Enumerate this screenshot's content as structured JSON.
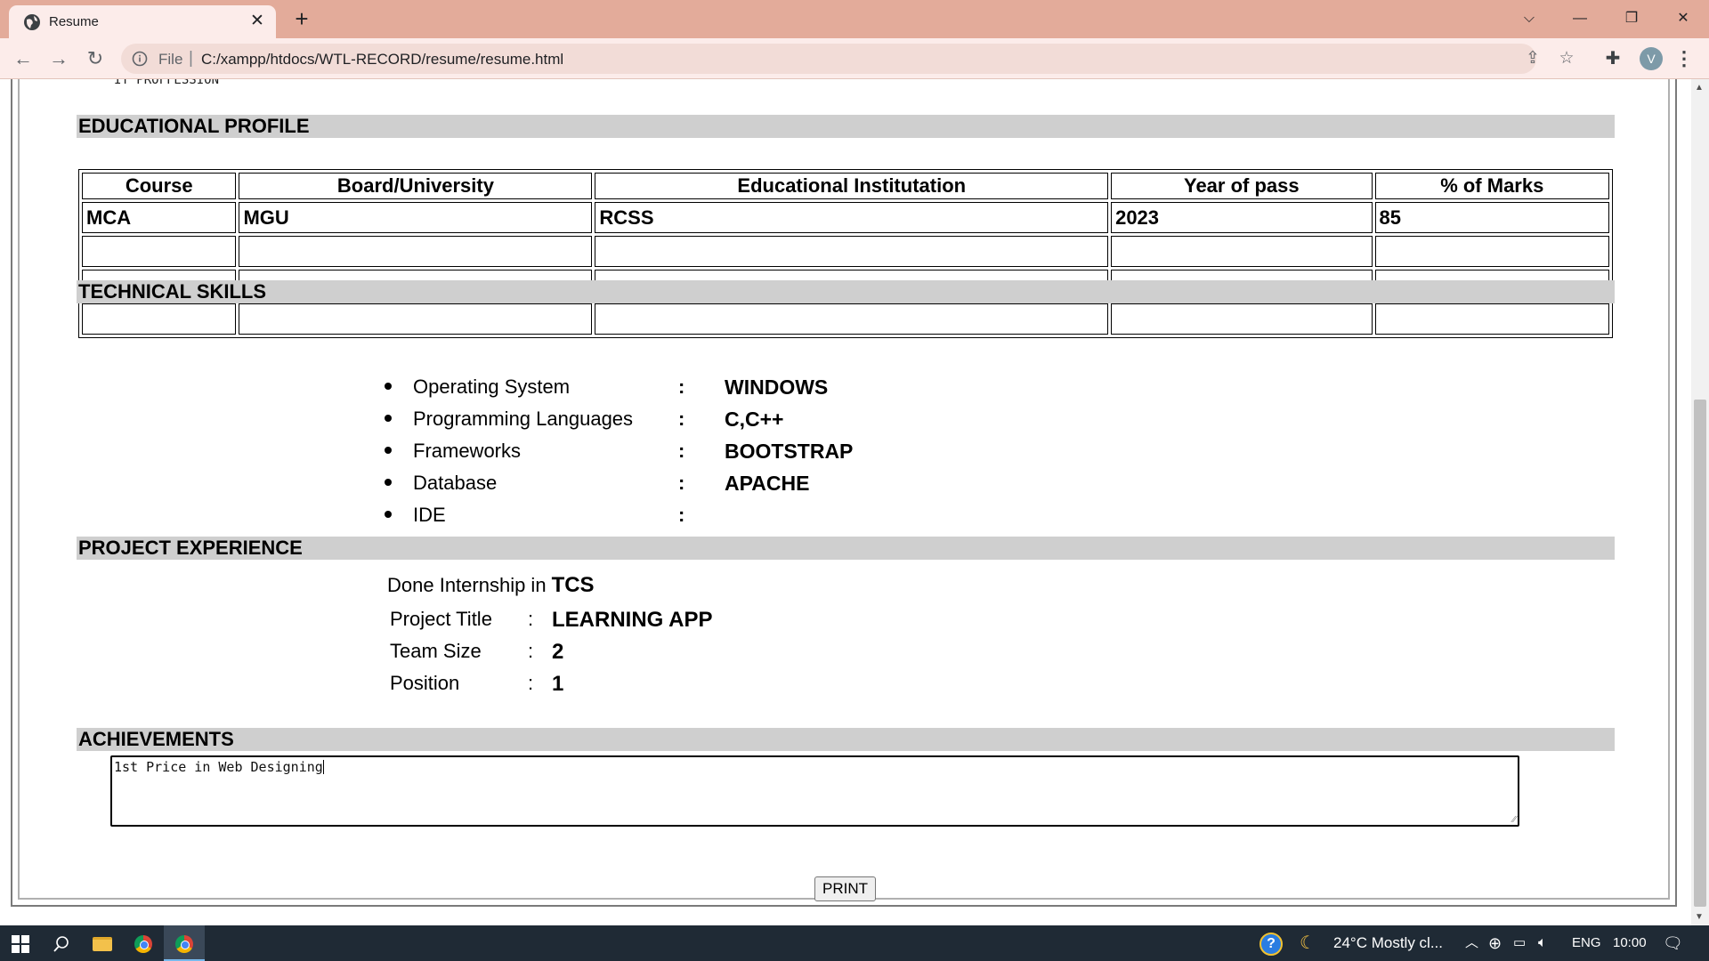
{
  "browser": {
    "tab_title": "Resume",
    "url_scheme": "File",
    "url_separator": "|",
    "url": "C:/xampp/htdocs/WTL-RECORD/resume/resume.html",
    "profile_initial": "V"
  },
  "page": {
    "top_partial_text": "IT PROFFESSION",
    "educational_profile": {
      "heading": "EDUCATIONAL PROFILE",
      "columns": [
        "Course",
        "Board/University",
        "Educational Institutation",
        "Year of pass",
        "% of Marks"
      ],
      "rows": [
        [
          "MCA",
          "MGU",
          "RCSS",
          "2023",
          "85"
        ],
        [
          "",
          "",
          "",
          "",
          ""
        ],
        [
          "",
          "",
          "",
          "",
          ""
        ],
        [
          "",
          "",
          "",
          "",
          ""
        ]
      ]
    },
    "technical_skills": {
      "heading": "TECHNICAL SKILLS",
      "separator": ":",
      "items": [
        {
          "label": "Operating System",
          "value": "WINDOWS"
        },
        {
          "label": "Programming Languages",
          "value": "C,C++"
        },
        {
          "label": "Frameworks",
          "value": "BOOTSTRAP"
        },
        {
          "label": "Database",
          "value": "APACHE"
        },
        {
          "label": "IDE",
          "value": ""
        }
      ]
    },
    "project_experience": {
      "heading": "PROJECT EXPERIENCE",
      "intro": "Done Internship in",
      "company": "TCS",
      "separator": ":",
      "fields": [
        {
          "label": "Project Title",
          "value": "LEARNING APP"
        },
        {
          "label": "Team Size",
          "value": "2"
        },
        {
          "label": "Position",
          "value": "1"
        }
      ]
    },
    "achievements": {
      "heading": "ACHIEVEMENTS",
      "text": "1st Price in Web Designing"
    },
    "print_label": "PRINT"
  },
  "taskbar": {
    "weather": "24°C  Mostly cl...",
    "language": "ENG",
    "time": "10:00"
  }
}
